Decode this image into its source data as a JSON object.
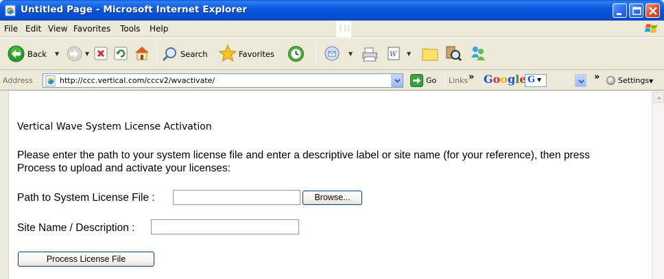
{
  "window": {
    "title": "Untitled Page - Microsoft Internet Explorer"
  },
  "menu": [
    "File",
    "Edit",
    "View",
    "Favorites",
    "Tools",
    "Help"
  ],
  "toolbar": {
    "back_label": "Back",
    "search_label": "Search",
    "favorites_label": "Favorites"
  },
  "address_bar": {
    "label": "Address",
    "url": "http://ccc.vertical.com/cccv2/wvactivate/",
    "go_label": "Go",
    "links_label": "Links",
    "links_chevron": "»",
    "google_logo": "Google",
    "google_g": "G",
    "google_chevron": "»",
    "settings_label": "Settings"
  },
  "page": {
    "heading": "Vertical Wave System License Activation",
    "instructions": "Please enter the path to your system license file and enter a descriptive label or site name (for your reference), then press Process to upload and activate your licenses:",
    "license_path_label": "Path to System License File :",
    "license_path_value": "",
    "browse_label": "Browse...",
    "site_name_label": "Site Name / Description :",
    "site_name_value": "",
    "process_label": "Process License File"
  },
  "colors": {
    "titlebar": "#0a5fde",
    "chrome": "#ece9d8",
    "close_button": "#e04c22",
    "input_border": "#7f9db9",
    "button_border": "#003c74"
  },
  "icons": [
    "ie-page-icon",
    "minimize-icon",
    "maximize-icon",
    "close-icon",
    "windows-flag-icon",
    "back-arrow-icon",
    "forward-arrow-icon",
    "stop-icon",
    "refresh-icon",
    "home-icon",
    "search-magnifier-icon",
    "favorites-star-icon",
    "history-icon",
    "mail-icon",
    "print-icon",
    "edit-word-icon",
    "folder-icon",
    "research-icon",
    "messenger-icon",
    "go-arrow-icon",
    "settings-icon",
    "scroll-up-arrow-icon"
  ]
}
